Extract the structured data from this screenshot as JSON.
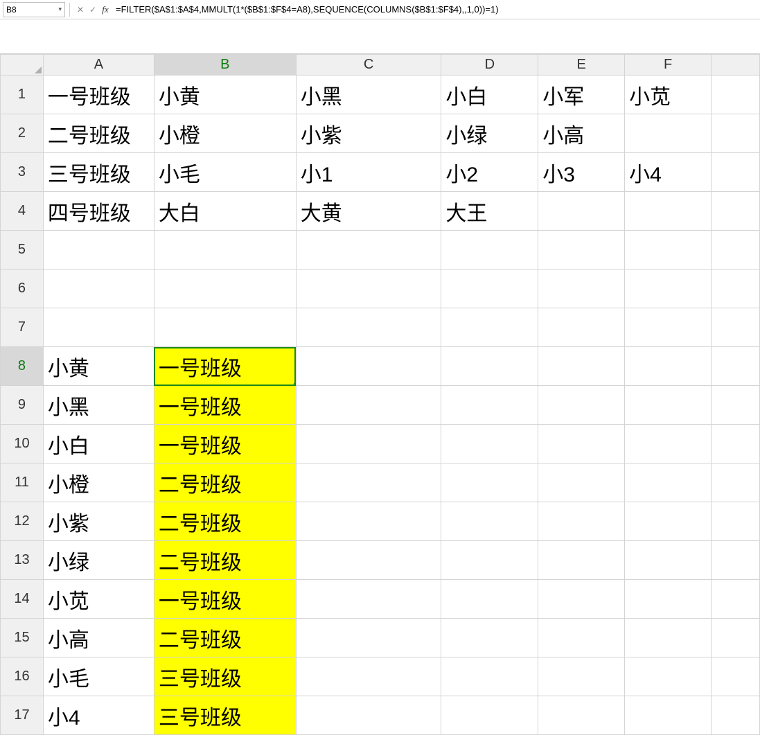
{
  "formula_bar": {
    "cell_ref": "B8",
    "formula": "=FILTER($A$1:$A$4,MMULT(1*($B$1:$F$4=A8),SEQUENCE(COLUMNS($B$1:$F$4),,1,0))=1)",
    "cancel_icon": "✕",
    "confirm_icon": "✓",
    "fx_label": "fx",
    "dropdown_icon": "▾"
  },
  "columns": [
    "A",
    "B",
    "C",
    "D",
    "E",
    "F"
  ],
  "rows": [
    1,
    2,
    3,
    4,
    5,
    6,
    7,
    8,
    9,
    10,
    11,
    12,
    13,
    14,
    15,
    16,
    17
  ],
  "active_cell": {
    "row": 8,
    "col": "B"
  },
  "grid": {
    "r1": {
      "A": "一号班级",
      "B": "小黄",
      "C": "小黑",
      "D": "小白",
      "E": "小军",
      "F": "小苋"
    },
    "r2": {
      "A": "二号班级",
      "B": "小橙",
      "C": "小紫",
      "D": "小绿",
      "E": "小高",
      "F": ""
    },
    "r3": {
      "A": "三号班级",
      "B": "小毛",
      "C": "小1",
      "D": "小2",
      "E": "小3",
      "F": "小4"
    },
    "r4": {
      "A": "四号班级",
      "B": "大白",
      "C": "大黄",
      "D": "大王",
      "E": "",
      "F": ""
    },
    "r5": {
      "A": "",
      "B": "",
      "C": "",
      "D": "",
      "E": "",
      "F": ""
    },
    "r6": {
      "A": "",
      "B": "",
      "C": "",
      "D": "",
      "E": "",
      "F": ""
    },
    "r7": {
      "A": "",
      "B": "",
      "C": "",
      "D": "",
      "E": "",
      "F": ""
    },
    "r8": {
      "A": "小黄",
      "B": "一号班级",
      "C": "",
      "D": "",
      "E": "",
      "F": ""
    },
    "r9": {
      "A": "小黑",
      "B": "一号班级",
      "C": "",
      "D": "",
      "E": "",
      "F": ""
    },
    "r10": {
      "A": "小白",
      "B": "一号班级",
      "C": "",
      "D": "",
      "E": "",
      "F": ""
    },
    "r11": {
      "A": "小橙",
      "B": "二号班级",
      "C": "",
      "D": "",
      "E": "",
      "F": ""
    },
    "r12": {
      "A": "小紫",
      "B": "二号班级",
      "C": "",
      "D": "",
      "E": "",
      "F": ""
    },
    "r13": {
      "A": "小绿",
      "B": "二号班级",
      "C": "",
      "D": "",
      "E": "",
      "F": ""
    },
    "r14": {
      "A": "小苋",
      "B": "一号班级",
      "C": "",
      "D": "",
      "E": "",
      "F": ""
    },
    "r15": {
      "A": "小高",
      "B": "二号班级",
      "C": "",
      "D": "",
      "E": "",
      "F": ""
    },
    "r16": {
      "A": "小毛",
      "B": "三号班级",
      "C": "",
      "D": "",
      "E": "",
      "F": ""
    },
    "r17": {
      "A": "小4",
      "B": "三号班级",
      "C": "",
      "D": "",
      "E": "",
      "F": ""
    }
  },
  "highlight": {
    "col": "B",
    "rows": [
      8,
      9,
      10,
      11,
      12,
      13,
      14,
      15,
      16,
      17
    ]
  }
}
